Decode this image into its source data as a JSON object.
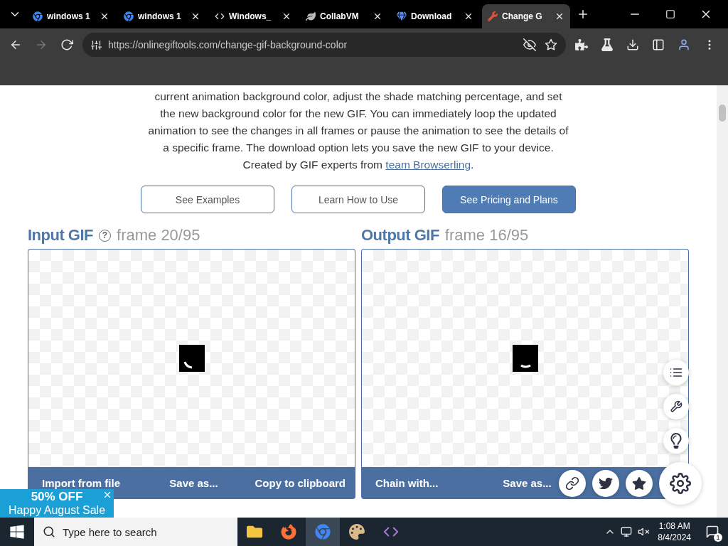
{
  "browser": {
    "tabs": [
      {
        "title": "windows 1",
        "selected": false
      },
      {
        "title": "windows 1",
        "selected": false
      },
      {
        "title": "Windows_",
        "selected": false
      },
      {
        "title": "CollabVM",
        "selected": false
      },
      {
        "title": "Download",
        "selected": false
      },
      {
        "title": "Change G",
        "selected": true
      }
    ],
    "address": "https://onlinegiftools.com/change-gif-background-color"
  },
  "intro": {
    "lines": [
      "current animation background color, adjust the shade matching percentage, and set",
      "the new background color for the new GIF. You can immediately loop the updated",
      "animation to see the changes in all frames or pause the animation to see the details of",
      "a specific frame. The download option lets you save the new GIF to your device."
    ],
    "credit": "Created by GIF experts from",
    "link": "team Browserling",
    "after": "."
  },
  "actions": [
    {
      "label": "See Examples",
      "primary": false
    },
    {
      "label": "Learn How to Use",
      "primary": false
    },
    {
      "label": "See Pricing and Plans",
      "primary": true
    }
  ],
  "panels": [
    {
      "title": "Input GIF",
      "help": "?",
      "frame": "frame 20/95",
      "buttons": [
        "Import from file",
        "Save as...",
        "Copy to clipboard"
      ]
    },
    {
      "title": "Output GIF",
      "frame": "frame 16/95",
      "buttons": [
        "Chain with...",
        "Save as..."
      ]
    }
  ],
  "promo": {
    "headline": "50% OFF",
    "text": "Happy August Sale"
  },
  "taskbar": {
    "search": {
      "placeholder": "Type here to search"
    },
    "time": "1:08 AM",
    "date": "8/4/2024",
    "notifications": "1"
  }
}
